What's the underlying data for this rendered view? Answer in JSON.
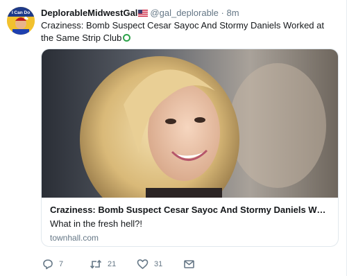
{
  "tweet": {
    "display_name": "DeplorableMidwestGal",
    "handle": "@gal_deplorable",
    "separator": "·",
    "time": "8m",
    "avatar_caption": "I Can Do",
    "text": "Craziness: Bomb Suspect Cesar Sayoc And Stormy Daniels Worked at the Same Strip Club"
  },
  "card": {
    "title": "Craziness: Bomb Suspect Cesar Sayoc And Stormy Daniels Worked at the Same Strip Club",
    "description": "What in the fresh hell?!",
    "domain": "townhall.com"
  },
  "actions": {
    "reply_count": "7",
    "retweet_count": "21",
    "like_count": "31"
  },
  "colors": {
    "text": "#14171a",
    "muted": "#657786",
    "border": "#e1e8ed"
  },
  "icons": [
    "avatar-image",
    "us-flag-icon",
    "green-circle-emoji",
    "reply-icon",
    "retweet-icon",
    "like-icon",
    "message-icon"
  ]
}
